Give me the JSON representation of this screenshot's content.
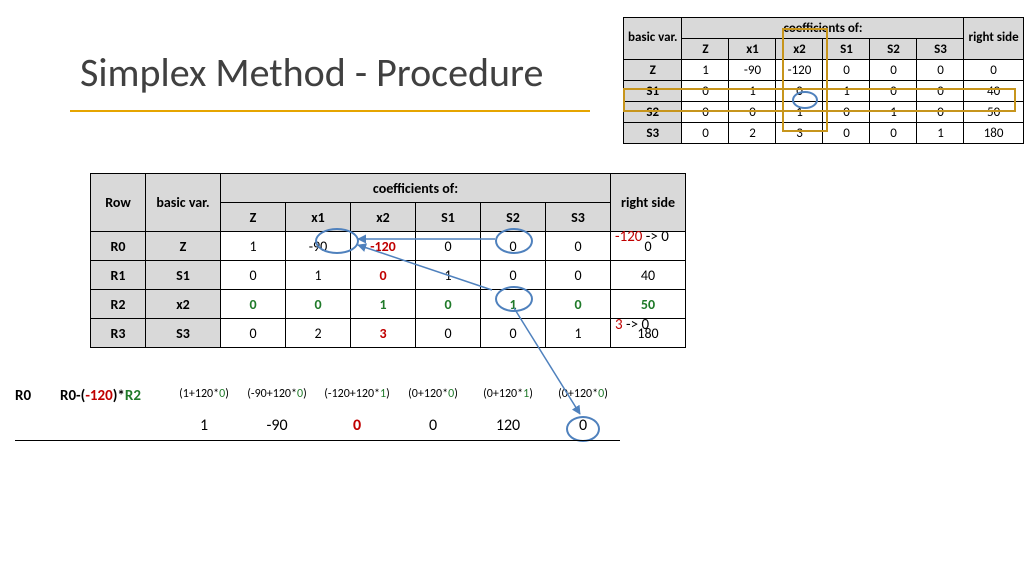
{
  "title": "Simplex Method - Procedure",
  "small_table": {
    "header_group": "coefficients of:",
    "bv_label": "basic var.",
    "rhs_label": "right side",
    "cols": [
      "Z",
      "x1",
      "x2",
      "S1",
      "S2",
      "S3"
    ],
    "rows": [
      {
        "bv": "Z",
        "vals": [
          "1",
          "-90",
          "-120",
          "0",
          "0",
          "0"
        ],
        "rhs": "0"
      },
      {
        "bv": "S1",
        "vals": [
          "0",
          "1",
          "0",
          "1",
          "0",
          "0"
        ],
        "rhs": "40"
      },
      {
        "bv": "S2",
        "vals": [
          "0",
          "0",
          "1",
          "0",
          "1",
          "0"
        ],
        "rhs": "50"
      },
      {
        "bv": "S3",
        "vals": [
          "0",
          "2",
          "3",
          "0",
          "0",
          "1"
        ],
        "rhs": "180"
      }
    ]
  },
  "main_table": {
    "row_label": "Row",
    "bv_label": "basic var.",
    "header_group": "coefficients of:",
    "rhs_label": "right side",
    "cols": [
      "Z",
      "x1",
      "x2",
      "S1",
      "S2",
      "S3"
    ],
    "rows": [
      {
        "row": "R0",
        "bv": "Z",
        "vals": [
          {
            "v": "1"
          },
          {
            "v": "-90"
          },
          {
            "v": "-120",
            "cls": "val-red"
          },
          {
            "v": "0"
          },
          {
            "v": "0"
          },
          {
            "v": "0"
          }
        ],
        "rhs": {
          "v": "0"
        }
      },
      {
        "row": "R1",
        "bv": "S1",
        "vals": [
          {
            "v": "0"
          },
          {
            "v": "1"
          },
          {
            "v": "0",
            "cls": "val-red"
          },
          {
            "v": "1"
          },
          {
            "v": "0"
          },
          {
            "v": "0"
          }
        ],
        "rhs": {
          "v": "40"
        }
      },
      {
        "row": "R2",
        "bv": "x2",
        "vals": [
          {
            "v": "0",
            "cls": "val-green"
          },
          {
            "v": "0",
            "cls": "val-green"
          },
          {
            "v": "1",
            "cls": "val-green"
          },
          {
            "v": "0",
            "cls": "val-green"
          },
          {
            "v": "1",
            "cls": "val-green"
          },
          {
            "v": "0",
            "cls": "val-green"
          }
        ],
        "rhs": {
          "v": "50",
          "cls": "val-green"
        }
      },
      {
        "row": "R3",
        "bv": "S3",
        "vals": [
          {
            "v": "0"
          },
          {
            "v": "2"
          },
          {
            "v": "3",
            "cls": "val-red"
          },
          {
            "v": "0"
          },
          {
            "v": "0"
          },
          {
            "v": "1"
          }
        ],
        "rhs": {
          "v": "180"
        }
      }
    ]
  },
  "annotations": {
    "r0": {
      "pivot_val": "-120",
      "arrow": " -> 0"
    },
    "r3": {
      "pivot_val": "3",
      "arrow": " -> 0"
    }
  },
  "calc": {
    "row_label": "R0",
    "expr_prefix": "R0-(",
    "expr_pivot": "-120",
    "expr_mid": ")*",
    "expr_row": "R2",
    "terms": [
      {
        "pre": "(1+120*",
        "g": "0",
        "post": ")"
      },
      {
        "pre": "(-90+120*",
        "g": "0",
        "post": ")"
      },
      {
        "pre": "(-120+120*",
        "g": "1",
        "post": ")"
      },
      {
        "pre": "(0+120*",
        "g": "0",
        "post": ")"
      },
      {
        "pre": "(0+120*",
        "g": "1",
        "post": ")"
      },
      {
        "pre": "(0+120*",
        "g": "0",
        "post": ")"
      }
    ],
    "result": [
      {
        "v": "1"
      },
      {
        "v": "-90"
      },
      {
        "v": "0",
        "cls": "val-red"
      },
      {
        "v": "0"
      },
      {
        "v": "120"
      },
      {
        "v": "0"
      }
    ]
  }
}
